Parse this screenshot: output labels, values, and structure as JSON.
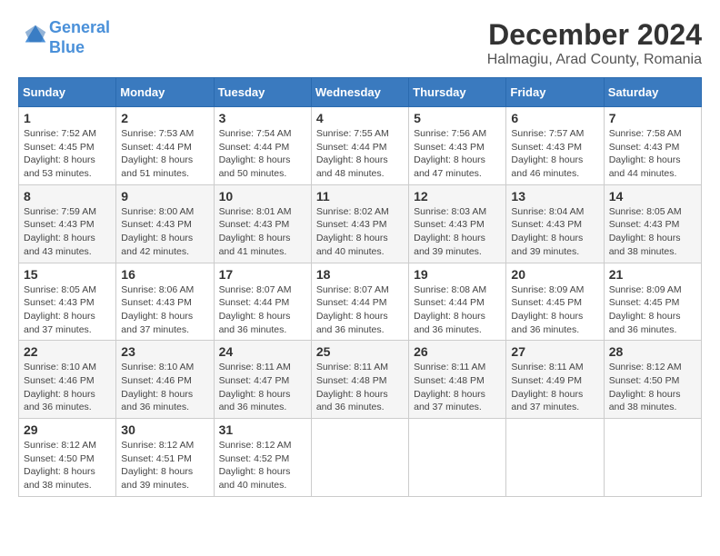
{
  "header": {
    "logo_line1": "General",
    "logo_line2": "Blue",
    "title": "December 2024",
    "subtitle": "Halmagiu, Arad County, Romania"
  },
  "weekdays": [
    "Sunday",
    "Monday",
    "Tuesday",
    "Wednesday",
    "Thursday",
    "Friday",
    "Saturday"
  ],
  "weeks": [
    [
      {
        "day": "1",
        "sunrise": "7:52 AM",
        "sunset": "4:45 PM",
        "daylight": "8 hours and 53 minutes."
      },
      {
        "day": "2",
        "sunrise": "7:53 AM",
        "sunset": "4:44 PM",
        "daylight": "8 hours and 51 minutes."
      },
      {
        "day": "3",
        "sunrise": "7:54 AM",
        "sunset": "4:44 PM",
        "daylight": "8 hours and 50 minutes."
      },
      {
        "day": "4",
        "sunrise": "7:55 AM",
        "sunset": "4:44 PM",
        "daylight": "8 hours and 48 minutes."
      },
      {
        "day": "5",
        "sunrise": "7:56 AM",
        "sunset": "4:43 PM",
        "daylight": "8 hours and 47 minutes."
      },
      {
        "day": "6",
        "sunrise": "7:57 AM",
        "sunset": "4:43 PM",
        "daylight": "8 hours and 46 minutes."
      },
      {
        "day": "7",
        "sunrise": "7:58 AM",
        "sunset": "4:43 PM",
        "daylight": "8 hours and 44 minutes."
      }
    ],
    [
      {
        "day": "8",
        "sunrise": "7:59 AM",
        "sunset": "4:43 PM",
        "daylight": "8 hours and 43 minutes."
      },
      {
        "day": "9",
        "sunrise": "8:00 AM",
        "sunset": "4:43 PM",
        "daylight": "8 hours and 42 minutes."
      },
      {
        "day": "10",
        "sunrise": "8:01 AM",
        "sunset": "4:43 PM",
        "daylight": "8 hours and 41 minutes."
      },
      {
        "day": "11",
        "sunrise": "8:02 AM",
        "sunset": "4:43 PM",
        "daylight": "8 hours and 40 minutes."
      },
      {
        "day": "12",
        "sunrise": "8:03 AM",
        "sunset": "4:43 PM",
        "daylight": "8 hours and 39 minutes."
      },
      {
        "day": "13",
        "sunrise": "8:04 AM",
        "sunset": "4:43 PM",
        "daylight": "8 hours and 39 minutes."
      },
      {
        "day": "14",
        "sunrise": "8:05 AM",
        "sunset": "4:43 PM",
        "daylight": "8 hours and 38 minutes."
      }
    ],
    [
      {
        "day": "15",
        "sunrise": "8:05 AM",
        "sunset": "4:43 PM",
        "daylight": "8 hours and 37 minutes."
      },
      {
        "day": "16",
        "sunrise": "8:06 AM",
        "sunset": "4:43 PM",
        "daylight": "8 hours and 37 minutes."
      },
      {
        "day": "17",
        "sunrise": "8:07 AM",
        "sunset": "4:44 PM",
        "daylight": "8 hours and 36 minutes."
      },
      {
        "day": "18",
        "sunrise": "8:07 AM",
        "sunset": "4:44 PM",
        "daylight": "8 hours and 36 minutes."
      },
      {
        "day": "19",
        "sunrise": "8:08 AM",
        "sunset": "4:44 PM",
        "daylight": "8 hours and 36 minutes."
      },
      {
        "day": "20",
        "sunrise": "8:09 AM",
        "sunset": "4:45 PM",
        "daylight": "8 hours and 36 minutes."
      },
      {
        "day": "21",
        "sunrise": "8:09 AM",
        "sunset": "4:45 PM",
        "daylight": "8 hours and 36 minutes."
      }
    ],
    [
      {
        "day": "22",
        "sunrise": "8:10 AM",
        "sunset": "4:46 PM",
        "daylight": "8 hours and 36 minutes."
      },
      {
        "day": "23",
        "sunrise": "8:10 AM",
        "sunset": "4:46 PM",
        "daylight": "8 hours and 36 minutes."
      },
      {
        "day": "24",
        "sunrise": "8:11 AM",
        "sunset": "4:47 PM",
        "daylight": "8 hours and 36 minutes."
      },
      {
        "day": "25",
        "sunrise": "8:11 AM",
        "sunset": "4:48 PM",
        "daylight": "8 hours and 36 minutes."
      },
      {
        "day": "26",
        "sunrise": "8:11 AM",
        "sunset": "4:48 PM",
        "daylight": "8 hours and 37 minutes."
      },
      {
        "day": "27",
        "sunrise": "8:11 AM",
        "sunset": "4:49 PM",
        "daylight": "8 hours and 37 minutes."
      },
      {
        "day": "28",
        "sunrise": "8:12 AM",
        "sunset": "4:50 PM",
        "daylight": "8 hours and 38 minutes."
      }
    ],
    [
      {
        "day": "29",
        "sunrise": "8:12 AM",
        "sunset": "4:50 PM",
        "daylight": "8 hours and 38 minutes."
      },
      {
        "day": "30",
        "sunrise": "8:12 AM",
        "sunset": "4:51 PM",
        "daylight": "8 hours and 39 minutes."
      },
      {
        "day": "31",
        "sunrise": "8:12 AM",
        "sunset": "4:52 PM",
        "daylight": "8 hours and 40 minutes."
      },
      null,
      null,
      null,
      null
    ]
  ],
  "labels": {
    "sunrise": "Sunrise:",
    "sunset": "Sunset:",
    "daylight": "Daylight:"
  }
}
